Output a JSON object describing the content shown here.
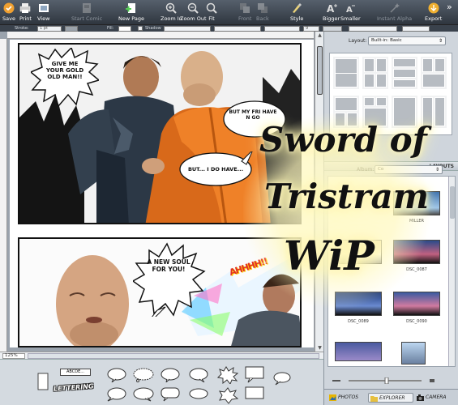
{
  "toolbar": {
    "save": "Save",
    "print": "Print",
    "view": "View",
    "start_comic": "Start Comic",
    "new_page": "New Page",
    "zoom_in": "Zoom In",
    "zoom_out": "Zoom Out",
    "fit": "Fit",
    "front": "Front",
    "back": "Back",
    "style": "Style",
    "bigger": "Bigger",
    "smaller": "Smaller",
    "instant_alpha": "Instant Alpha",
    "export": "Export",
    "more": "»"
  },
  "format_bar": {
    "stroke_label": "Stroke:",
    "stroke_value": "1 pt",
    "fill_label": "Fill:",
    "shadow_label": "Shadow",
    "font_size": "9"
  },
  "comic": {
    "balloon1": "GIVE ME YOUR GOLD OLD MAN!!",
    "balloon2": "BUT MY FRI HAVE N GO",
    "balloon3": "BUT... I DO HAVE...",
    "balloon4": "A NEW SOUL FOR YOU!",
    "sfx": "AHHHH!!"
  },
  "status": {
    "zoom": "125%"
  },
  "palette": {
    "caption_sample": "ABCDE...",
    "lettering_label": "LETTERING"
  },
  "sidebar": {
    "layout_label": "Layout:",
    "layout_value": "Built-in: Basic",
    "layouts_header": "LAYOUTS",
    "album_label": "Album:",
    "album_value": "Co",
    "photos": [
      {
        "caption": "MILLER"
      },
      {
        "caption": ""
      },
      {
        "caption": "DSC_0087"
      },
      {
        "caption": "DSC_0089"
      },
      {
        "caption": "DSC_0090"
      },
      {
        "caption": ""
      },
      {
        "caption": ""
      }
    ],
    "tabs": [
      "PHOTOS",
      "EXPLORER",
      "CAMERA"
    ]
  },
  "watermark": {
    "line1": "Sword of",
    "line2": "Tristram",
    "line3": "WiP"
  },
  "colors": {
    "toolbar_top": "#56606c",
    "toolbar_bottom": "#2f363f",
    "robe": "#e8731e",
    "glow": "#fff7c0"
  }
}
